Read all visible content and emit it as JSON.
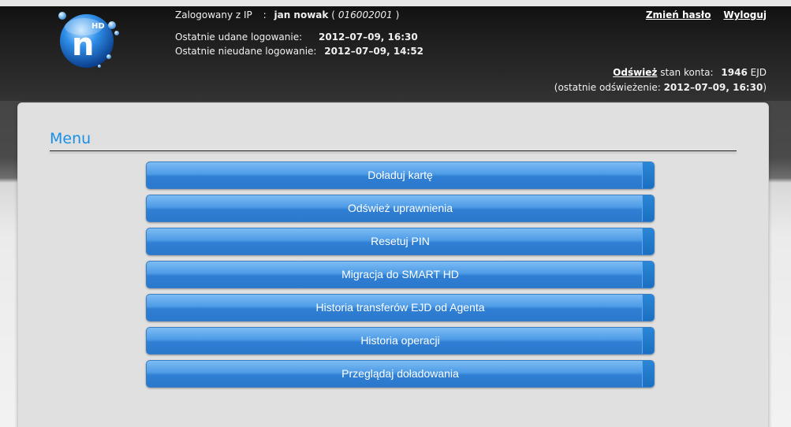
{
  "header": {
    "logo_text": "HD",
    "logo_letter": "n",
    "logged_in_label": "Zalogowany z IP",
    "logged_in_sep": ":",
    "user_name": "jan nowak",
    "user_id": "016002001",
    "last_success_label": "Ostatnie udane logowanie:",
    "last_success_value": "2012–07–09, 16:30",
    "last_failed_label": "Ostatnie nieudane logowanie:",
    "last_failed_value": "2012–07–09, 14:52",
    "change_password_label": "Zmień hasło",
    "logout_label": "Wyloguj",
    "refresh_label": "Odśwież",
    "balance_label": "stan konta:",
    "balance_value": "1946",
    "balance_unit": "EJD",
    "last_refresh_label": "(ostatnie odświeżenie:",
    "last_refresh_value": "2012–07–09, 16:30",
    "last_refresh_close": ")"
  },
  "menu": {
    "title": "Menu",
    "items": [
      {
        "label": "Doładuj kartę"
      },
      {
        "label": "Odśwież uprawnienia"
      },
      {
        "label": "Resetuj PIN"
      },
      {
        "label": "Migracja do SMART HD"
      },
      {
        "label": "Historia transferów EJD od Agenta"
      },
      {
        "label": "Historia operacji"
      },
      {
        "label": "Przeglądaj doładowania"
      }
    ]
  },
  "colors": {
    "accent": "#1a8fe6",
    "button": "#3d8fe0",
    "header_bg": "#1e1e1e"
  }
}
